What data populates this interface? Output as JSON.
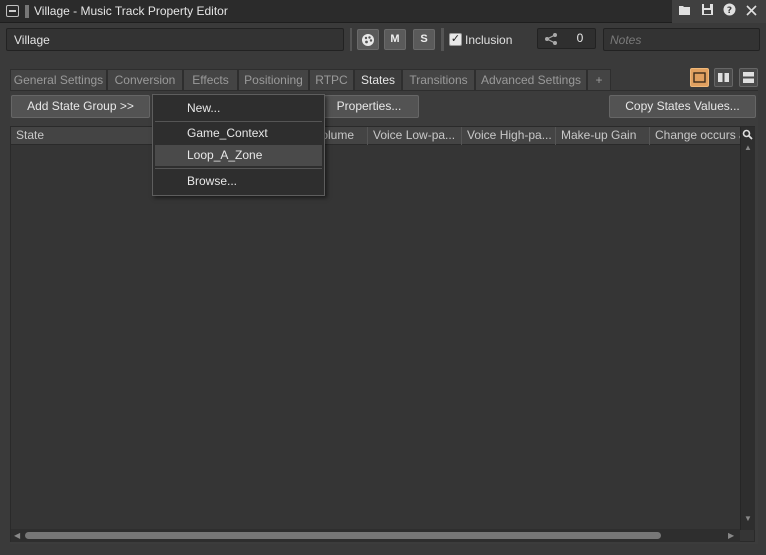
{
  "window": {
    "title": "Village - Music Track Property Editor"
  },
  "object_name": "Village",
  "header": {
    "mute_label": "M",
    "solo_label": "S",
    "inclusion_label": "Inclusion",
    "inclusion_checked": "✓",
    "share_count": "0",
    "notes_placeholder": "Notes"
  },
  "tabs": [
    {
      "label": "General Settings"
    },
    {
      "label": "Conversion"
    },
    {
      "label": "Effects"
    },
    {
      "label": "Positioning"
    },
    {
      "label": "RTPC"
    },
    {
      "label": "States",
      "active": true
    },
    {
      "label": "Transitions"
    },
    {
      "label": "Advanced Settings"
    },
    {
      "label": "+"
    }
  ],
  "buttons": {
    "add_state_group": "Add State Group >>",
    "properties": "Properties...",
    "copy_states_values": "Copy States Values..."
  },
  "table": {
    "columns": [
      "State",
      "Volume",
      "Voice Low-pa...",
      "Voice High-pa...",
      "Make-up Gain",
      "Change occurs at"
    ]
  },
  "context_menu": {
    "items": [
      "New...",
      "Game_Context",
      "Loop_A_Zone",
      "Browse..."
    ],
    "highlighted": "Loop_A_Zone"
  },
  "colors": {
    "accent_orange": "#e0a060",
    "background": "#3a3a3a",
    "titlebar": "#2b2b2b"
  }
}
